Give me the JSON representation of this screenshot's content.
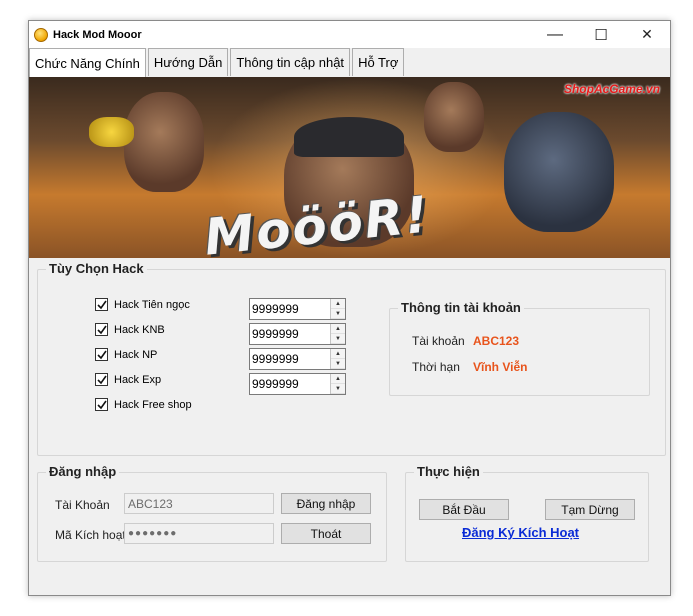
{
  "window": {
    "title": "Hack Mod Mooor",
    "controls": {
      "minimize": "—",
      "maximize": "☐",
      "close": "✕"
    }
  },
  "tabs": [
    {
      "label": "Chức Năng Chính",
      "active": true
    },
    {
      "label": "Hướng Dẫn",
      "active": false
    },
    {
      "label": "Thông tin cập nhật",
      "active": false
    },
    {
      "label": "Hỗ Trợ",
      "active": false
    }
  ],
  "banner": {
    "watermark": "ShopAcGame.vn",
    "logo_text": "MoööR!"
  },
  "hack_options": {
    "title": "Tùy Chọn Hack",
    "items": [
      {
        "label": "Hack Tiên ngọc",
        "checked": true,
        "value": "9999999"
      },
      {
        "label": "Hack KNB",
        "checked": true,
        "value": "9999999"
      },
      {
        "label": "Hack NP",
        "checked": true,
        "value": "9999999"
      },
      {
        "label": "Hack Exp",
        "checked": true,
        "value": "9999999"
      },
      {
        "label": "Hack Free shop",
        "checked": true
      }
    ]
  },
  "account_info": {
    "title": "Thông tin tài khoản",
    "account_label": "Tài khoản",
    "account_value": "ABC123",
    "duration_label": "Thời hạn",
    "duration_value": "Vĩnh Viễn"
  },
  "login": {
    "title": "Đăng nhập",
    "account_label": "Tài Khoản",
    "account_value": "ABC123",
    "code_label": "Mã Kích hoạt",
    "code_value": "●●●●●●●",
    "login_button": "Đăng nhập",
    "exit_button": "Thoát"
  },
  "execute": {
    "title": "Thực hiện",
    "start_button": "Bắt Đầu",
    "pause_button": "Tạm Dừng",
    "register_link": "Đăng Ký Kích Hoạt"
  },
  "colors": {
    "accent_value": "#e8541c",
    "link": "#0a2bd6",
    "window_bg": "#f0f0f0"
  }
}
